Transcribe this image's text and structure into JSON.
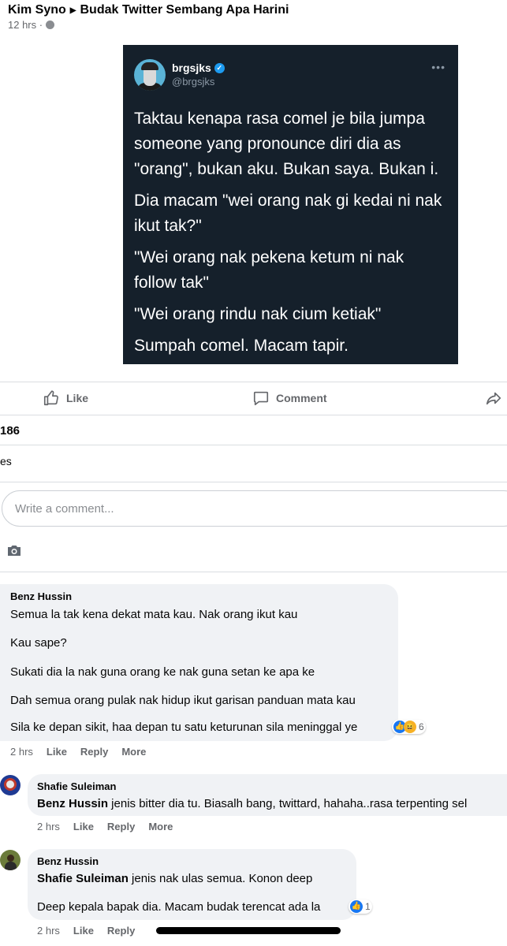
{
  "post": {
    "author": "Kim Syno",
    "group": "Budak Twitter Sembang Apa Harini",
    "time": "12 hrs ·"
  },
  "tweet": {
    "name": "brgsjks",
    "handle": "@brgsjks",
    "paragraphs": [
      "Taktau kenapa rasa comel je bila jumpa someone yang pronounce diri dia as \"orang\", bukan aku. Bukan saya. Bukan i.",
      "Dia macam \"wei orang nak gi kedai ni nak ikut tak?\"",
      "\"Wei orang nak pekena ketum ni nak follow tak\"",
      "\"Wei orang rindu nak cium ketiak\"",
      "Sumpah comel. Macam tapir."
    ]
  },
  "actions": {
    "like": "Like",
    "comment": "Comment"
  },
  "stats": {
    "count": "186",
    "seen": "es"
  },
  "comment_box": {
    "placeholder": "Write a comment..."
  },
  "comments": [
    {
      "name": "Benz Hussin",
      "lines": [
        "Semua la tak kena dekat mata kau. Nak orang ikut kau",
        "Kau sape?",
        "Sukati dia la nak guna orang ke nak guna setan ke apa ke",
        "Dah semua orang pulak nak hidup ikut garisan panduan mata kau",
        "Sila ke depan sikit, haa depan tu satu keturunan sila meninggal ye"
      ],
      "reactions": "6",
      "time": "2 hrs",
      "like": "Like",
      "reply": "Reply",
      "more": "More"
    },
    {
      "name": "Shafie Suleiman",
      "tag": "Benz Hussin",
      "text": " jenis bitter dia tu. Biasalh bang, twittard, hahaha..rasa terpenting sel",
      "time": "2 hrs",
      "like": "Like",
      "reply": "Reply",
      "more": "More"
    },
    {
      "name": "Benz Hussin",
      "tag": "Shafie Suleiman",
      "text": " jenis nak ulas semua. Konon deep",
      "line2": "Deep kepala bapak dia. Macam budak terencat ada la",
      "reactions": "1",
      "time": "2 hrs",
      "like": "Like",
      "reply": "Reply"
    }
  ]
}
